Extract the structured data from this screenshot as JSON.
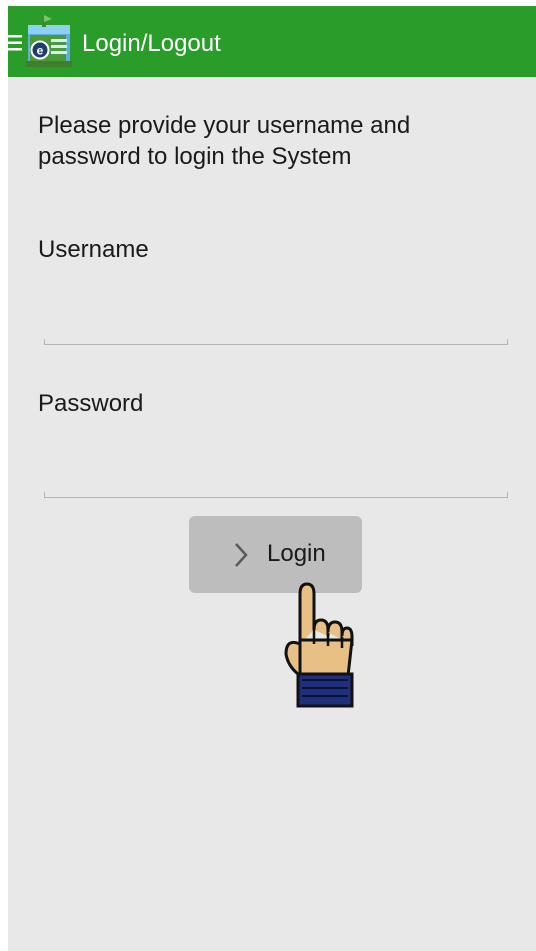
{
  "app_bar": {
    "title": "Login/Logout",
    "background_color": "#2a9c2a",
    "menu_icon": "hamburger-menu-icon",
    "app_icon": "app-logo-icon"
  },
  "form": {
    "instructions": "Please provide your username and password to login the System",
    "username": {
      "label": "Username",
      "value": "",
      "placeholder": ""
    },
    "password": {
      "label": "Password",
      "value": "",
      "placeholder": ""
    },
    "login_button": {
      "label": "Login",
      "icon": "chevron-right-icon"
    }
  },
  "overlay": {
    "pointer_icon": "pointing-hand-icon"
  }
}
